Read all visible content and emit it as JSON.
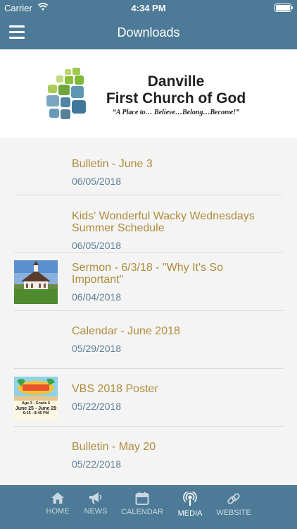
{
  "status": {
    "carrier": "Carrier",
    "time": "4:34 PM"
  },
  "nav": {
    "title": "Downloads"
  },
  "logo": {
    "name_line1": "Danville",
    "name_line2": "First Church of God",
    "tagline": "“A Place to… Believe…Belong…Become!”"
  },
  "items": [
    {
      "title": "Bulletin - June 3",
      "date": "06/05/2018"
    },
    {
      "title": "Kids' Wonderful Wacky Wednesdays Summer Schedule",
      "date": "06/05/2018"
    },
    {
      "title": "Sermon - 6/3/18 - \"Why It's So Important\"",
      "date": "06/04/2018"
    },
    {
      "title": "Calendar - June 2018",
      "date": "05/29/2018"
    },
    {
      "title": "VBS 2018 Poster",
      "date": "05/22/2018",
      "thumb_text": {
        "line1": "Age 3 - Grade 6",
        "line2": "June 25 - June 29",
        "line3": "6:15 - 8:45 PM"
      }
    },
    {
      "title": "Bulletin - May 20",
      "date": "05/22/2018"
    }
  ],
  "tabs": [
    {
      "label": "HOME",
      "icon": "home-icon"
    },
    {
      "label": "NEWS",
      "icon": "megaphone-icon"
    },
    {
      "label": "CALENDAR",
      "icon": "calendar-icon"
    },
    {
      "label": "MEDIA",
      "icon": "podcast-icon",
      "active": true
    },
    {
      "label": "WEBSITE",
      "icon": "link-icon"
    }
  ],
  "colors": {
    "bar": "#4d7a96",
    "title_gold": "#b08c3c",
    "date_blue": "#5e7f96",
    "tab_inactive": "#c7d6e0",
    "tab_active": "#ffffff"
  }
}
